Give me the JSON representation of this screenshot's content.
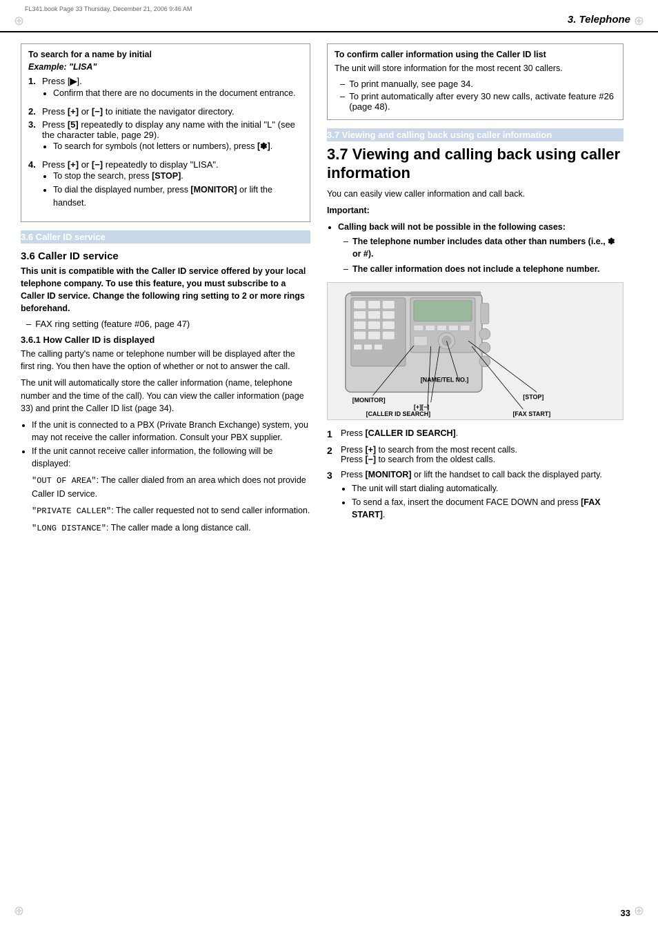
{
  "page": {
    "file_info": "FL341.book  Page 33  Thursday, December 21, 2006  9:46 AM",
    "header_title": "3. Telephone",
    "page_number": "33"
  },
  "left_column": {
    "bordered_box": {
      "title": "To search for a name by initial",
      "subtitle": "Example: \"LISA\"",
      "steps": [
        {
          "num": "1.",
          "text": "Press [",
          "key": "▶",
          "text2": "].",
          "bullets": [
            "Confirm that there are no documents in the document entrance."
          ]
        },
        {
          "num": "2.",
          "text": "Press [+] or [−] to initiate the navigator directory."
        },
        {
          "num": "3.",
          "text": "Press [5] repeatedly to display any name with the initial \"L\" (see the character table, page 29).",
          "bullets": [
            "To search for symbols (not letters or numbers), press [✽]."
          ]
        },
        {
          "num": "4.",
          "text": "Press [+] or [−] repeatedly to display \"LISA\".",
          "bullets": [
            "To stop the search, press [STOP].",
            "To dial the displayed number, press [MONITOR] or lift the handset."
          ]
        }
      ]
    },
    "caller_id_section": {
      "section_bar": "3.6 Caller ID service",
      "intro_bold": "This unit is compatible with the Caller ID service offered by your local telephone company. To use this feature, you must subscribe to a Caller ID service. Change the following ring setting to 2 or more rings beforehand.",
      "dash_items": [
        "FAX ring setting (feature #06, page 47)"
      ],
      "subsection_title": "3.6.1 How Caller ID is displayed",
      "paragraphs": [
        "The calling party's name or telephone number will be displayed after the first ring. You then have the option of whether or not to answer the call.",
        "The unit will automatically store the caller information (name, telephone number and the time of the call). You can view the caller information (page 33) and print the Caller ID list (page 34)."
      ],
      "bullets": [
        "If the unit is connected to a PBX (Private Branch Exchange) system, you may not receive the caller information. Consult your PBX supplier.",
        "If the unit cannot receive caller information, the following will be displayed:"
      ],
      "monospace_items": [
        {
          "code": "\"OUT OF AREA\"",
          "desc": ": The caller dialed from an area which does not provide Caller ID service."
        },
        {
          "code": "\"PRIVATE CALLER\"",
          "desc": ": The caller requested not to send caller information."
        },
        {
          "code": "\"LONG DISTANCE\"",
          "desc": ": The caller made a long distance call."
        }
      ]
    }
  },
  "right_column": {
    "confirm_box": {
      "title": "To confirm caller information using the Caller ID list",
      "text": "The unit will store information for the most recent 30 callers.",
      "dash_items": [
        "To print manually, see page 34.",
        "To print automatically after every 30 new calls, activate feature #26 (page 48)."
      ]
    },
    "big_section": {
      "bar_label": "3.7 Viewing and calling back using caller information",
      "title": "3.7 Viewing and calling back using caller information",
      "intro": "You can easily view caller information and call back.",
      "important_label": "Important:",
      "important_bullets": [
        {
          "bold": "Calling back will not be possible in the following cases:",
          "sub_dashes": [
            "The telephone number includes data other than numbers (i.e., ✽ or #).",
            "The caller information does not include a telephone number."
          ]
        }
      ]
    },
    "device_labels": {
      "monitor": "[MONITOR]",
      "stop": "[STOP]",
      "plus_minus": "[+][−]",
      "caller_id_search": "[CALLER ID SEARCH]",
      "fax_start": "[FAX START]",
      "name_tel": "[NAME/TEL NO.]"
    },
    "steps": [
      {
        "num": "1",
        "text": "Press [CALLER ID SEARCH]."
      },
      {
        "num": "2",
        "text": "Press [+] to search from the most recent calls.",
        "extra": "Press [−] to search from the oldest calls."
      },
      {
        "num": "3",
        "text": "Press [MONITOR] or lift the handset to call back the displayed party.",
        "bullets": [
          "The unit will start dialing automatically.",
          "To send a fax, insert the document FACE DOWN and press [FAX START]."
        ]
      }
    ]
  }
}
